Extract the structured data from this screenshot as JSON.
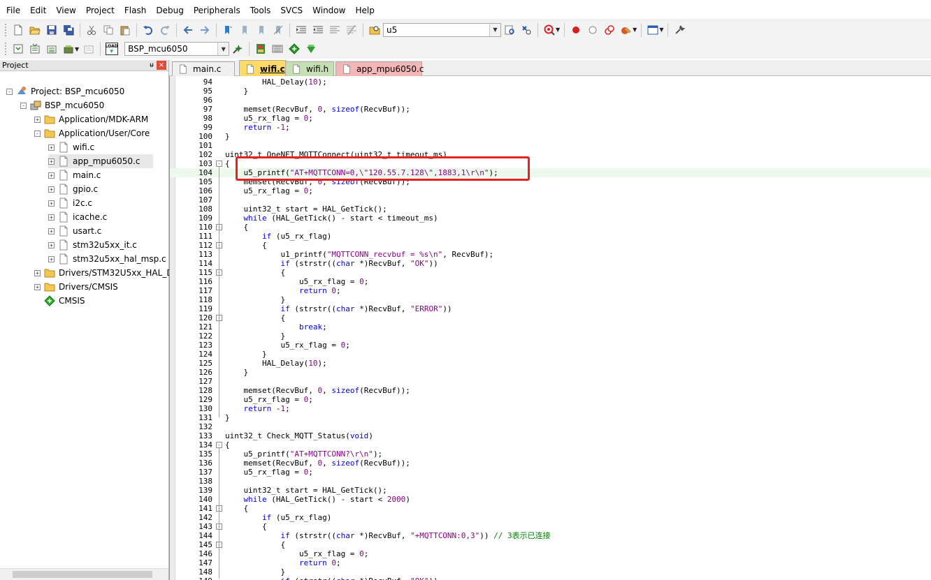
{
  "menu": [
    "File",
    "Edit",
    "View",
    "Project",
    "Flash",
    "Debug",
    "Peripherals",
    "Tools",
    "SVCS",
    "Window",
    "Help"
  ],
  "toolbar1": {
    "buttons": [
      "new-file",
      "open-file",
      "save",
      "save-all",
      "cut",
      "copy",
      "paste",
      "undo",
      "redo",
      "navigate-back",
      "navigate-forward",
      "insert-bookmark",
      "prev-bookmark",
      "next-bookmark",
      "clear-bookmarks",
      "indent",
      "unindent",
      "comment-selection",
      "uncomment-selection",
      "find-in-files"
    ],
    "search_value": "u5",
    "buttons_right": [
      "browse",
      "incremental-find",
      "debug-session",
      "breakpoint-insert",
      "breakpoint-disable",
      "breakpoint-kill",
      "breakpoint-manage",
      "window-layout",
      "configure"
    ]
  },
  "toolbar2": {
    "buttons": [
      "translate",
      "build",
      "rebuild",
      "batch-build",
      "stop-build",
      "download"
    ],
    "load_label": "LOAD",
    "target_value": "BSP_mcu6050",
    "buttons_right": [
      "target-options",
      "file-extensions",
      "manage-rte",
      "select-packs",
      "pack-installer"
    ]
  },
  "project_panel": {
    "title": "Project",
    "pin_glyph": "ᵾ",
    "close_glyph": "×",
    "tree": [
      {
        "label": "Project: BSP_mcu6050",
        "depth": 0,
        "exp": "-",
        "icon": "project-icon"
      },
      {
        "label": "BSP_mcu6050",
        "depth": 1,
        "exp": "-",
        "icon": "target-icon"
      },
      {
        "label": "Application/MDK-ARM",
        "depth": 2,
        "exp": "+",
        "icon": "folder-icon"
      },
      {
        "label": "Application/User/Core",
        "depth": 2,
        "exp": "-",
        "icon": "folder-icon"
      },
      {
        "label": "wifi.c",
        "depth": 3,
        "exp": "+",
        "icon": "file-icon"
      },
      {
        "label": "app_mpu6050.c",
        "depth": 3,
        "exp": "+",
        "icon": "file-icon",
        "selected": true
      },
      {
        "label": "main.c",
        "depth": 3,
        "exp": "+",
        "icon": "file-icon"
      },
      {
        "label": "gpio.c",
        "depth": 3,
        "exp": "+",
        "icon": "file-icon"
      },
      {
        "label": "i2c.c",
        "depth": 3,
        "exp": "+",
        "icon": "file-icon"
      },
      {
        "label": "icache.c",
        "depth": 3,
        "exp": "+",
        "icon": "file-icon"
      },
      {
        "label": "usart.c",
        "depth": 3,
        "exp": "+",
        "icon": "file-icon"
      },
      {
        "label": "stm32u5xx_it.c",
        "depth": 3,
        "exp": "+",
        "icon": "file-icon"
      },
      {
        "label": "stm32u5xx_hal_msp.c",
        "depth": 3,
        "exp": "+",
        "icon": "file-icon"
      },
      {
        "label": "Drivers/STM32U5xx_HAL_Driver",
        "depth": 2,
        "exp": "+",
        "icon": "folder-icon"
      },
      {
        "label": "Drivers/CMSIS",
        "depth": 2,
        "exp": "+",
        "icon": "folder-icon"
      },
      {
        "label": "CMSIS",
        "depth": 2,
        "exp": "",
        "icon": "component-icon"
      }
    ]
  },
  "tabs": [
    {
      "label": "main.c",
      "color": "#f0f0f0",
      "active": false
    },
    {
      "label": "wifi.c",
      "color": "#ffd966",
      "active": true
    },
    {
      "label": "wifi.h",
      "color": "#c6e0b4",
      "active": false
    },
    {
      "label": "app_mpu6050.c",
      "color": "#f4b6b6",
      "active": false
    }
  ],
  "code": [
    {
      "n": 94,
      "t": "        HAL_Delay(10);"
    },
    {
      "n": 95,
      "t": "    }"
    },
    {
      "n": 96,
      "t": ""
    },
    {
      "n": 97,
      "t": "    memset(RecvBuf, 0, sizeof(RecvBuf));"
    },
    {
      "n": 98,
      "t": "    u5_rx_flag = 0;"
    },
    {
      "n": 99,
      "t": "    return -1;"
    },
    {
      "n": 100,
      "t": "}"
    },
    {
      "n": 101,
      "t": ""
    },
    {
      "n": 102,
      "t": "uint32_t OneNET_MQTTConnect(uint32_t timeout_ms)"
    },
    {
      "n": 103,
      "t": "{",
      "fold": "-"
    },
    {
      "n": 104,
      "t": "    u5_printf(\"AT+MQTTCONN=0,\\\"120.55.7.128\\\",1883,1\\r\\n\");",
      "hl": true
    },
    {
      "n": 105,
      "t": "    memset(RecvBuf, 0, sizeof(RecvBuf));"
    },
    {
      "n": 106,
      "t": "    u5_rx_flag = 0;"
    },
    {
      "n": 107,
      "t": ""
    },
    {
      "n": 108,
      "t": "    uint32_t start = HAL_GetTick();"
    },
    {
      "n": 109,
      "t": "    while (HAL_GetTick() - start < timeout_ms)"
    },
    {
      "n": 110,
      "t": "    {",
      "fold": "-"
    },
    {
      "n": 111,
      "t": "        if (u5_rx_flag)"
    },
    {
      "n": 112,
      "t": "        {",
      "fold": "-"
    },
    {
      "n": 113,
      "t": "            u1_printf(\"MQTTCONN_recvbuf = %s\\n\", RecvBuf);"
    },
    {
      "n": 114,
      "t": "            if (strstr((char *)RecvBuf, \"OK\"))"
    },
    {
      "n": 115,
      "t": "            {",
      "fold": "-"
    },
    {
      "n": 116,
      "t": "                u5_rx_flag = 0;"
    },
    {
      "n": 117,
      "t": "                return 0;"
    },
    {
      "n": 118,
      "t": "            }"
    },
    {
      "n": 119,
      "t": "            if (strstr((char *)RecvBuf, \"ERROR\"))"
    },
    {
      "n": 120,
      "t": "            {",
      "fold": "-"
    },
    {
      "n": 121,
      "t": "                break;"
    },
    {
      "n": 122,
      "t": "            }"
    },
    {
      "n": 123,
      "t": "            u5_rx_flag = 0;"
    },
    {
      "n": 124,
      "t": "        }"
    },
    {
      "n": 125,
      "t": "        HAL_Delay(10);"
    },
    {
      "n": 126,
      "t": "    }"
    },
    {
      "n": 127,
      "t": ""
    },
    {
      "n": 128,
      "t": "    memset(RecvBuf, 0, sizeof(RecvBuf));"
    },
    {
      "n": 129,
      "t": "    u5_rx_flag = 0;"
    },
    {
      "n": 130,
      "t": "    return -1;"
    },
    {
      "n": 131,
      "t": "}"
    },
    {
      "n": 132,
      "t": ""
    },
    {
      "n": 133,
      "t": "uint32_t Check_MQTT_Status(void)"
    },
    {
      "n": 134,
      "t": "{",
      "fold": "-"
    },
    {
      "n": 135,
      "t": "    u5_printf(\"AT+MQTTCONN?\\r\\n\");"
    },
    {
      "n": 136,
      "t": "    memset(RecvBuf, 0, sizeof(RecvBuf));"
    },
    {
      "n": 137,
      "t": "    u5_rx_flag = 0;"
    },
    {
      "n": 138,
      "t": ""
    },
    {
      "n": 139,
      "t": "    uint32_t start = HAL_GetTick();"
    },
    {
      "n": 140,
      "t": "    while (HAL_GetTick() - start < 2000)"
    },
    {
      "n": 141,
      "t": "    {",
      "fold": "-"
    },
    {
      "n": 142,
      "t": "        if (u5_rx_flag)"
    },
    {
      "n": 143,
      "t": "        {",
      "fold": "-"
    },
    {
      "n": 144,
      "t": "            if (strstr((char *)RecvBuf, \"+MQTTCONN:0,3\")) // 3表示已连接"
    },
    {
      "n": 145,
      "t": "            {",
      "fold": "-"
    },
    {
      "n": 146,
      "t": "                u5_rx_flag = 0;"
    },
    {
      "n": 147,
      "t": "                return 0;"
    },
    {
      "n": 148,
      "t": "            }"
    },
    {
      "n": 149,
      "t": "            if (strstr((char *)RecvBuf, \"OK\"))"
    }
  ],
  "colors": {
    "keyword": "#0000e6",
    "string": "#8b008b",
    "comment": "#008000",
    "annotation": "#e8221b",
    "active_tab": "#ffd966"
  }
}
